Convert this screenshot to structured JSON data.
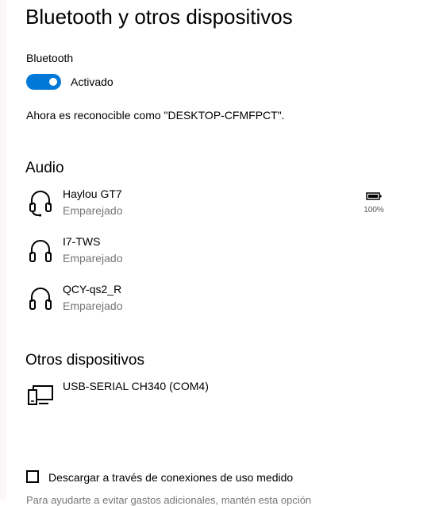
{
  "page": {
    "title": "Bluetooth y otros dispositivos"
  },
  "bluetooth": {
    "label": "Bluetooth",
    "toggle_state": "Activado",
    "toggle_on": true,
    "discoverable_text": "Ahora es reconocible como \"DESKTOP-CFMFPCT\"."
  },
  "audio": {
    "title": "Audio",
    "devices": [
      {
        "name": "Haylou GT7",
        "status": "Emparejado",
        "icon": "headset-icon",
        "battery": "100%",
        "battery_level": 1.0
      },
      {
        "name": "I7-TWS",
        "status": "Emparejado",
        "icon": "headphones-icon"
      },
      {
        "name": "QCY-qs2_R",
        "status": "Emparejado",
        "icon": "headphones-icon"
      }
    ]
  },
  "other": {
    "title": "Otros dispositivos",
    "devices": [
      {
        "name": "USB-SERIAL CH340 (COM4)",
        "icon": "devices-icon"
      }
    ]
  },
  "metered": {
    "label": "Descargar a través de conexiones de uso medido",
    "checked": false,
    "help": "Para ayudarte a evitar gastos adicionales, mantén esta opción"
  },
  "colors": {
    "accent": "#0078d7",
    "secondary_text": "#767676"
  }
}
